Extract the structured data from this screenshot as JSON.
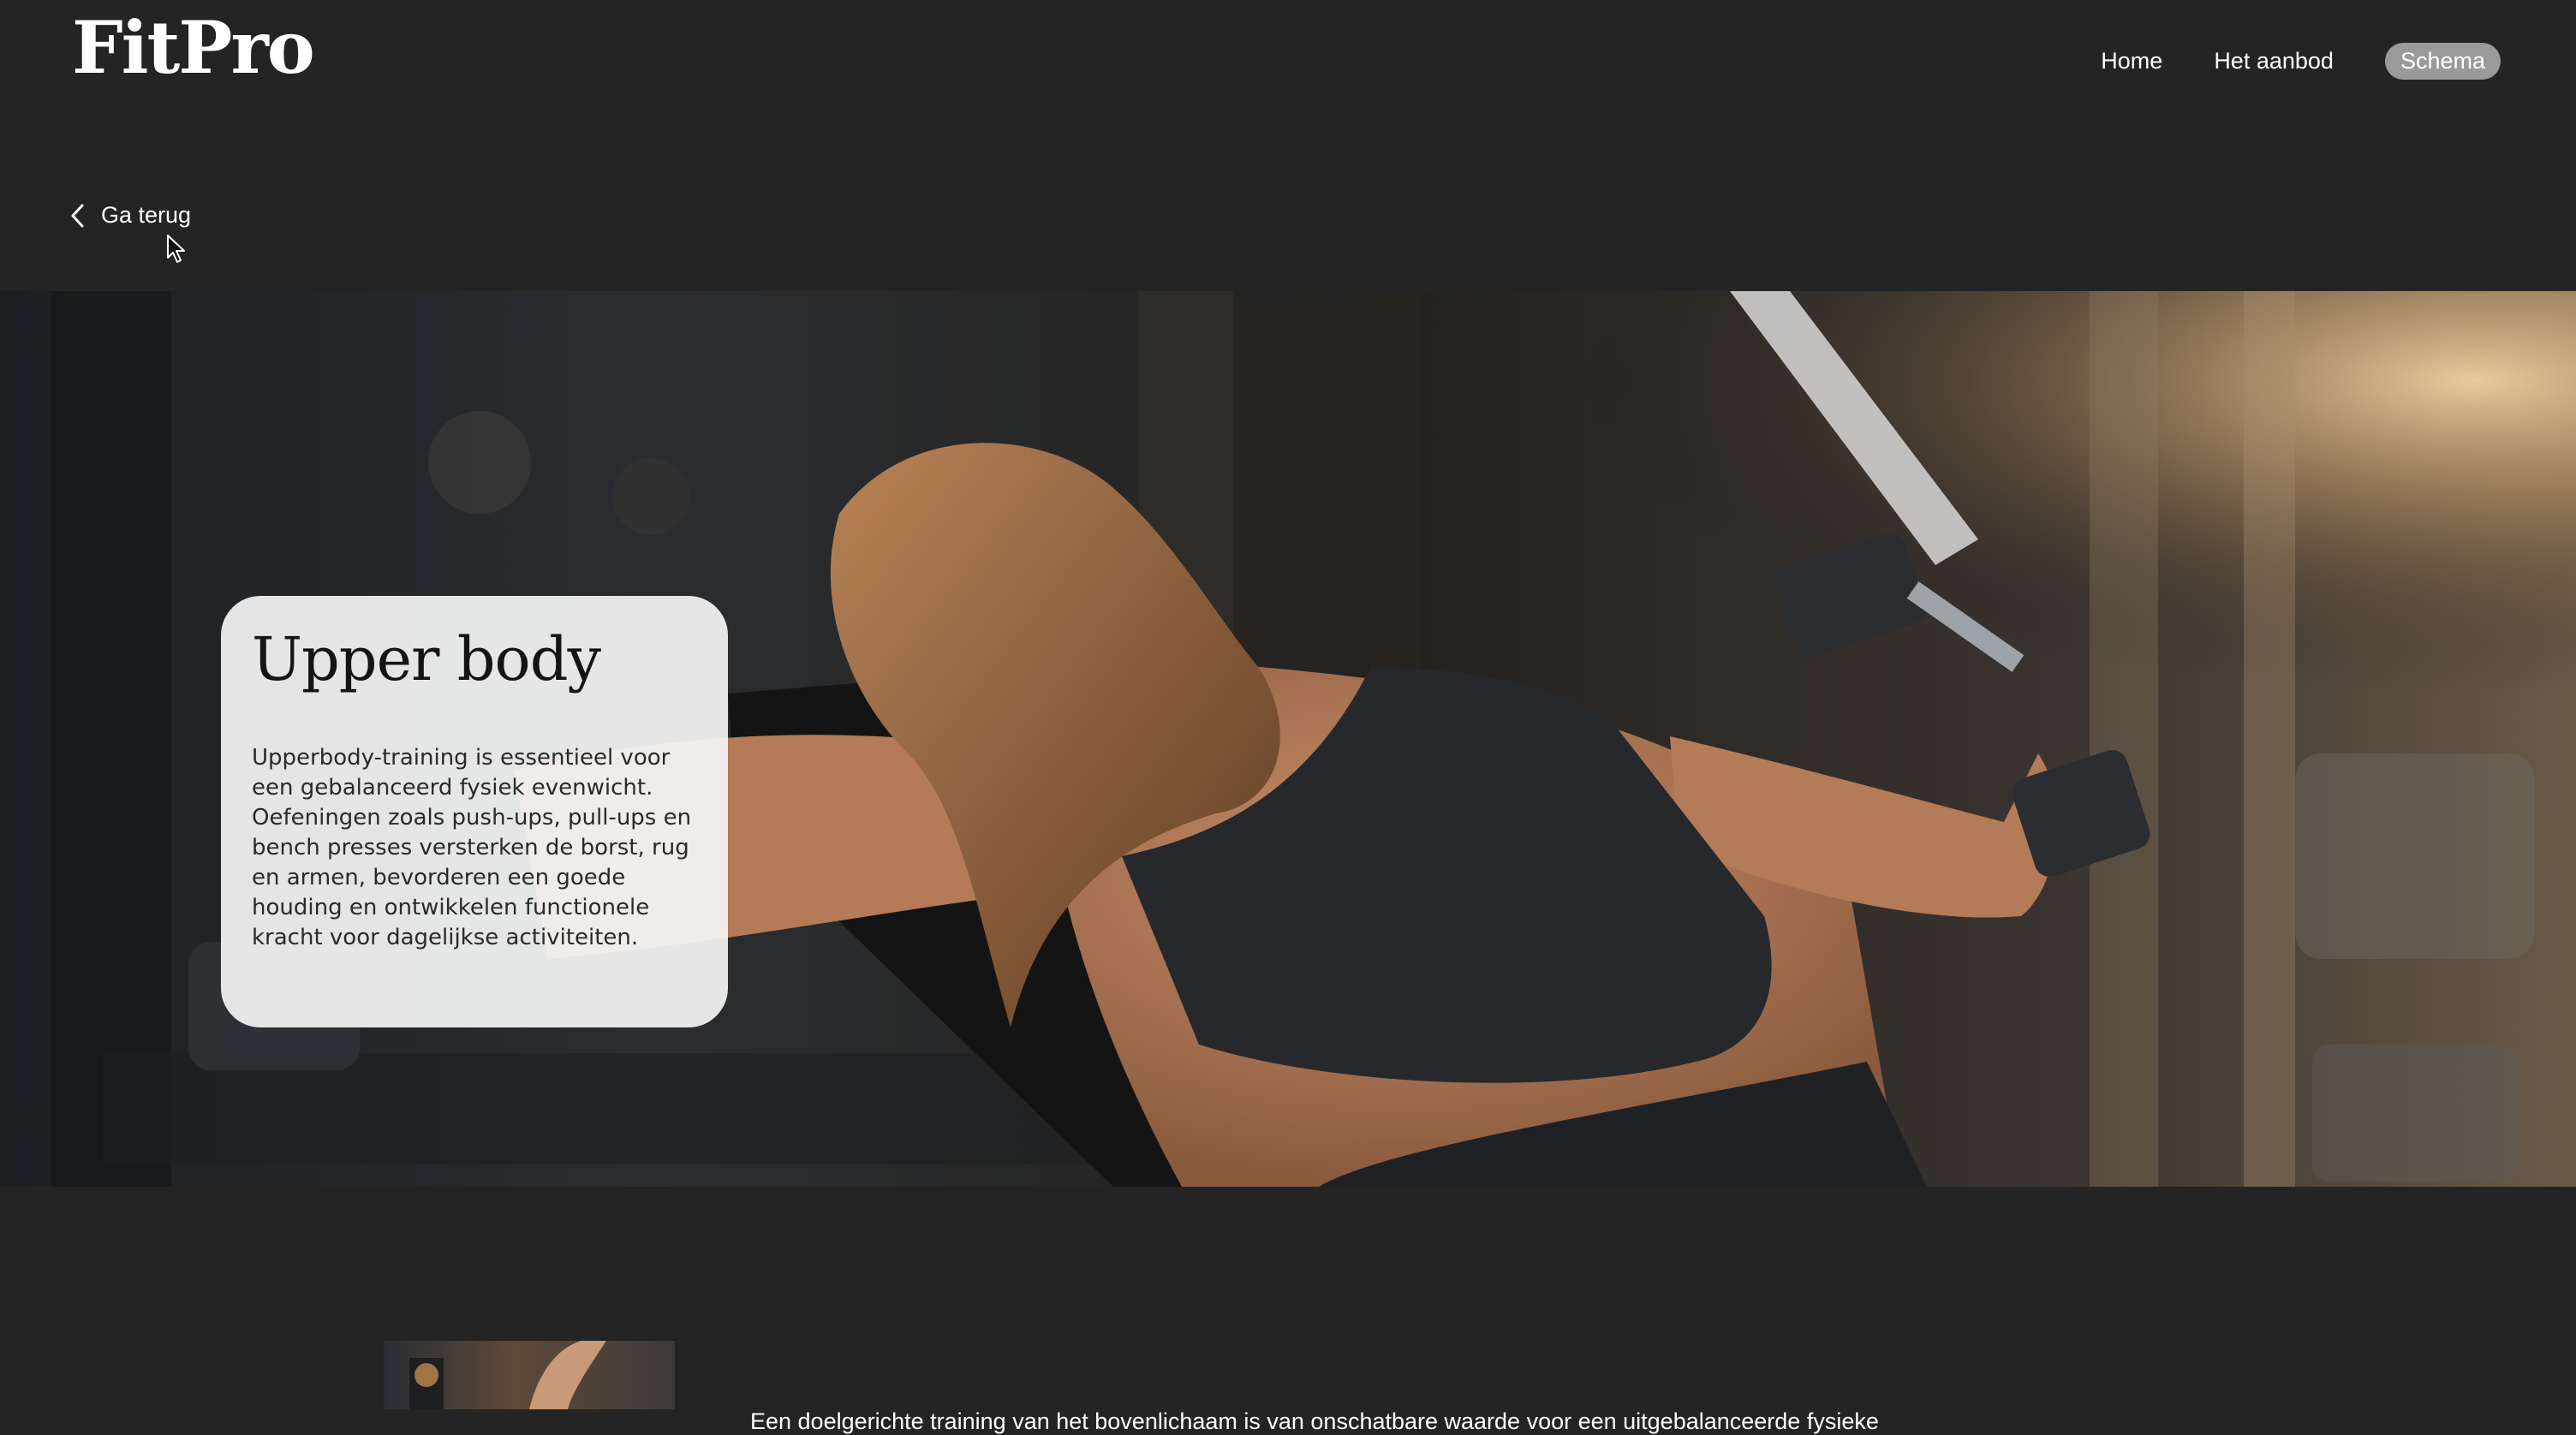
{
  "header": {
    "logo": "FitPro",
    "nav": {
      "home": "Home",
      "offer": "Het aanbod",
      "schedule": "Schema"
    }
  },
  "back": {
    "label": "Ga terug",
    "icon": "chevron-left-icon"
  },
  "hero": {
    "card": {
      "title": "Upper body",
      "text": "Upperbody-training is essentieel voor een gebalanceerd fysiek evenwicht. Oefeningen zoals push-ups, pull-ups en bench presses versterken de borst, rug en armen, bevorderen een goede houding en ontwikkelen functionele kracht voor dagelijkse activiteiten."
    }
  },
  "bottom": {
    "intro": "Een doelgerichte training van het bovenlichaam is van onschatbare waarde voor een uitgebalanceerde fysieke"
  },
  "colors": {
    "background": "#242424",
    "text": "#ffffff",
    "pill": "#9a9a9a",
    "card": "#f4f4f4"
  }
}
